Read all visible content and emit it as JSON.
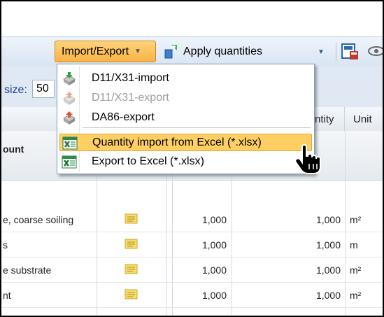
{
  "toolbar": {
    "import_export_label": "Import/Export",
    "apply_quantities_label": "Apply quantities"
  },
  "pager": {
    "size_label": "size:",
    "size_value": "50"
  },
  "header": {
    "quantity": "ntity",
    "unit": "Unit",
    "amount": "ount"
  },
  "menu": {
    "items": [
      {
        "label": "D11/X31-import",
        "icon": "d11-import-icon",
        "state": "normal"
      },
      {
        "label": "D11/X31-export",
        "icon": "d11-export-icon",
        "state": "disabled"
      },
      {
        "label": "DA86-export",
        "icon": "da86-export-icon",
        "state": "normal"
      },
      {
        "label": "Quantity import from Excel (*.xlsx)",
        "icon": "excel-icon",
        "state": "highlighted"
      },
      {
        "label": "Export to Excel (*.xlsx)",
        "icon": "excel-icon",
        "state": "normal"
      }
    ]
  },
  "rows": [
    {
      "description": "e, coarse soiling",
      "qty1": "1,000",
      "qty2": "1,000",
      "unit": "m²"
    },
    {
      "description": "s",
      "qty1": "1,000",
      "qty2": "1,000",
      "unit": "m"
    },
    {
      "description": "e substrate",
      "qty1": "1,000",
      "qty2": "1,000",
      "unit": "m²"
    },
    {
      "description": "nt",
      "qty1": "1,000",
      "qty2": "1,000",
      "unit": "m²"
    }
  ],
  "colors": {
    "accent": "#f9b347",
    "toolbar": "#d9e5f3",
    "menu_highlight": "#ffcf63"
  }
}
